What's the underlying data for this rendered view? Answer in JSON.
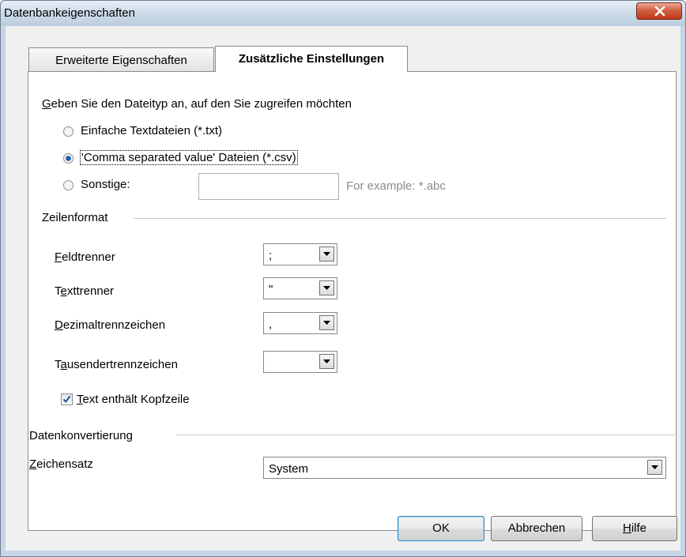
{
  "window": {
    "title": "Datenbankeigenschaften"
  },
  "tabs": [
    {
      "label": "Erweiterte Eigenschaften",
      "active": false
    },
    {
      "label": "Zusätzliche Einstellungen",
      "active": true
    }
  ],
  "filetype": {
    "prompt_mnemonic": "G",
    "prompt_rest": "eben Sie den Dateityp an, auf den Sie zugreifen möchten",
    "options": [
      {
        "label": "Einfache Textdateien (*.txt)",
        "selected": false
      },
      {
        "label": "'Comma separated value' Dateien (*.csv)",
        "selected": true
      },
      {
        "label": "Sonstige:",
        "selected": false
      }
    ],
    "other_value": "",
    "other_hint": "For example: *.abc"
  },
  "rowformat": {
    "section_label": "Zeilenformat",
    "field_separator": {
      "pre": "",
      "mnemonic": "F",
      "post": "eldtrenner",
      "value": ";"
    },
    "text_separator": {
      "pre": "T",
      "mnemonic": "e",
      "post": "xttrenner",
      "value": "\""
    },
    "decimal_separator": {
      "pre": "",
      "mnemonic": "D",
      "post": "ezimaltrennzeichen",
      "value": ","
    },
    "thousands_separator": {
      "pre": "T",
      "mnemonic": "a",
      "post": "usendertrennzeichen",
      "value": ""
    },
    "header_checkbox": {
      "mnemonic": "T",
      "post": "ext enthält Kopfzeile",
      "checked": true
    }
  },
  "conversion": {
    "section_label": "Datenkonvertierung",
    "charset_mnemonic": "Z",
    "charset_post": "eichensatz",
    "charset_value": "System"
  },
  "buttons": {
    "ok": "OK",
    "cancel": "Abbrechen",
    "help_mnemonic": "H",
    "help_post": "ilfe"
  },
  "colors": {
    "selected_radio": "#1a5fb4",
    "hint_text": "#8a8a8a",
    "check_mark": "#2b4a8b"
  }
}
